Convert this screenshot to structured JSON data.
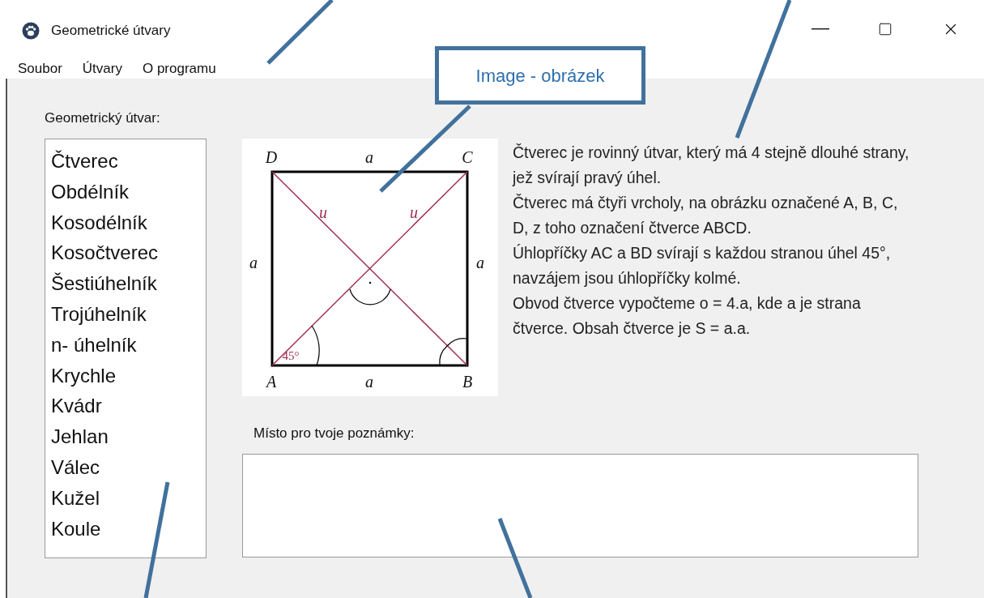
{
  "window": {
    "title": "Geometrické útvary"
  },
  "menu": [
    {
      "label": "Soubor"
    },
    {
      "label": "Útvary"
    },
    {
      "label": "O programu"
    }
  ],
  "shape_list": {
    "label": "Geometrický útvar:",
    "items": [
      {
        "label": "Čtverec",
        "selected": false
      },
      {
        "label": "Obdélník",
        "selected": false
      },
      {
        "label": "Kosodélník",
        "selected": false
      },
      {
        "label": "Kosočtverec",
        "selected": false
      },
      {
        "label": "Šestiúhelník",
        "selected": false
      },
      {
        "label": "Trojúhelník",
        "selected": false
      },
      {
        "label": "n- úhelník",
        "selected": false
      },
      {
        "label": "Krychle",
        "selected": false
      },
      {
        "label": "Kvádr",
        "selected": false
      },
      {
        "label": "Jehlan",
        "selected": false
      },
      {
        "label": "Válec",
        "selected": false
      },
      {
        "label": "Kužel",
        "selected": false
      },
      {
        "label": "Koule",
        "selected": false
      }
    ]
  },
  "diagram": {
    "labels": [
      "D",
      "a",
      "C",
      "a",
      "a",
      "u",
      "u",
      "A",
      "a",
      "B",
      "45°"
    ]
  },
  "description": [
    "Čtverec je rovinný útvar, který má 4 stejně dlouhé strany, jež svírají pravý úhel.",
    "Čtverec má čtyři vrcholy, na obrázku označené A, B, C, D, z toho označení čtverce ABCD.",
    "Úhlopříčky AC a BD svírají s každou stranou úhel 45°, navzájem jsou úhlopříčky kolmé.",
    "Obvod čtverce vypočteme o = 4.a, kde a je strana čtverce. Obsah čtverce je S = a.a."
  ],
  "notes": {
    "label": "Místo pro tvoje poznámky:"
  },
  "callout": {
    "text": "Image - obrázek"
  }
}
